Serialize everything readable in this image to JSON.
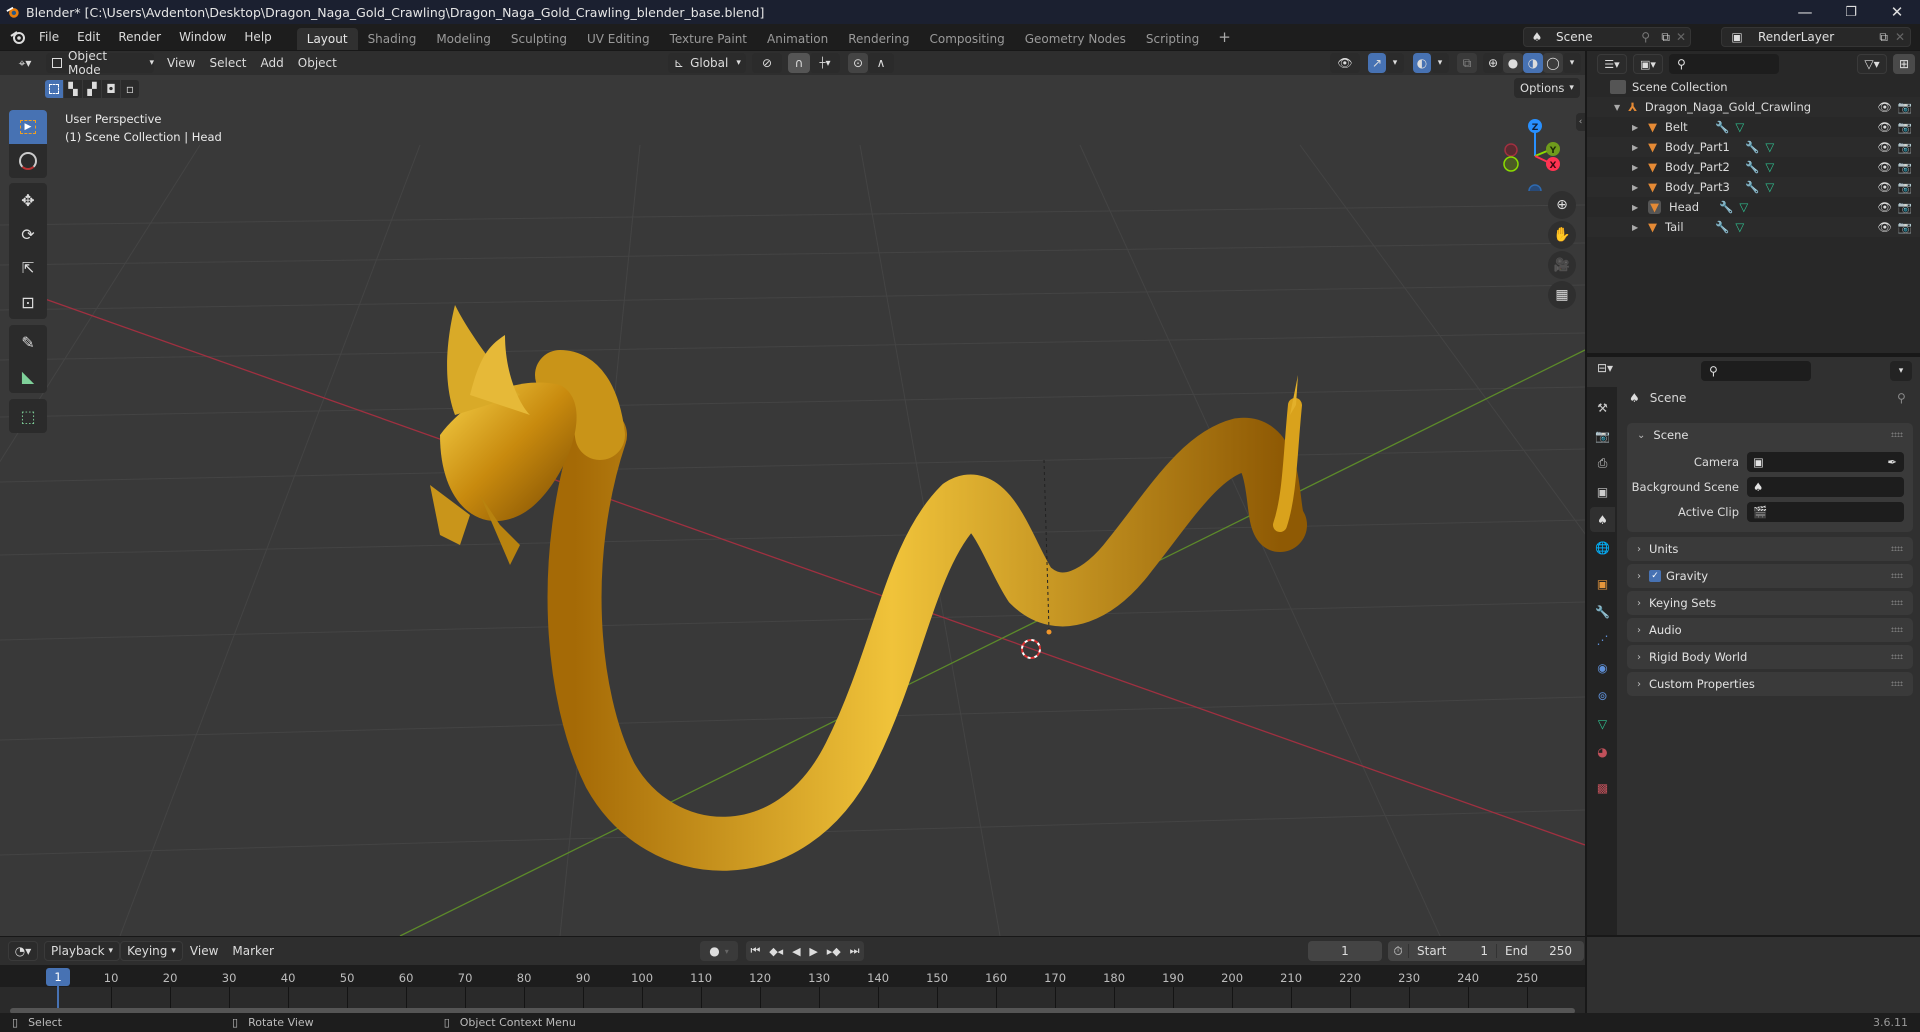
{
  "titlebar": {
    "title": "Blender* [C:\\Users\\Avdenton\\Desktop\\Dragon_Naga_Gold_Crawling\\Dragon_Naga_Gold_Crawling_blender_base.blend]",
    "minimize": "—",
    "maximize": "❐",
    "close": "✕"
  },
  "menubar": {
    "menus": [
      "File",
      "Edit",
      "Render",
      "Window",
      "Help"
    ],
    "workspaces": [
      "Layout",
      "Shading",
      "Modeling",
      "Sculpting",
      "UV Editing",
      "Texture Paint",
      "Animation",
      "Rendering",
      "Compositing",
      "Geometry Nodes",
      "Scripting"
    ],
    "active_workspace": "Layout",
    "add_workspace": "+",
    "scene_name": "Scene",
    "view_layer": "RenderLayer"
  },
  "viewport": {
    "mode": "Object Mode",
    "menus": [
      "View",
      "Select",
      "Add",
      "Object"
    ],
    "transform_orientation": "Global",
    "options_label": "Options",
    "overlay_text_1": "User Perspective",
    "overlay_text_2": "(1) Scene Collection | Head",
    "gizmo": {
      "z": "Z",
      "y": "Y",
      "x": "X"
    },
    "colors": {
      "x_axis": "#ff3352",
      "y_axis": "#8bdc00",
      "z_axis": "#2890ff",
      "gold": "#d4a017"
    }
  },
  "outliner": {
    "root": "Scene Collection",
    "collection": "Dragon_Naga_Gold_Crawling",
    "objects": [
      {
        "name": "Belt",
        "selected": false
      },
      {
        "name": "Body_Part1",
        "selected": false
      },
      {
        "name": "Body_Part2",
        "selected": false
      },
      {
        "name": "Body_Part3",
        "selected": false
      },
      {
        "name": "Head",
        "selected": true
      },
      {
        "name": "Tail",
        "selected": false
      }
    ]
  },
  "properties": {
    "context_title": "Scene",
    "scene_panel": {
      "title": "Scene",
      "rows": [
        {
          "label": "Camera",
          "value": ""
        },
        {
          "label": "Background Scene",
          "value": ""
        },
        {
          "label": "Active Clip",
          "value": ""
        }
      ]
    },
    "collapsed_panels": [
      {
        "title": "Units",
        "checkbox": false
      },
      {
        "title": "Gravity",
        "checkbox": true
      },
      {
        "title": "Keying Sets",
        "checkbox": false
      },
      {
        "title": "Audio",
        "checkbox": false
      },
      {
        "title": "Rigid Body World",
        "checkbox": false
      },
      {
        "title": "Custom Properties",
        "checkbox": false
      }
    ]
  },
  "timeline": {
    "menus": [
      "Playback",
      "Keying",
      "View",
      "Marker"
    ],
    "current_frame": "1",
    "start_label": "Start",
    "start": "1",
    "end_label": "End",
    "end": "250",
    "frame_ticks": [
      "10",
      "20",
      "30",
      "40",
      "50",
      "60",
      "70",
      "80",
      "90",
      "100",
      "110",
      "120",
      "130",
      "140",
      "150",
      "160",
      "170",
      "180",
      "190",
      "200",
      "210",
      "220",
      "230",
      "240",
      "250"
    ],
    "playhead": "1"
  },
  "statusbar": {
    "select": "Select",
    "rotate": "Rotate View",
    "context_menu": "Object Context Menu",
    "version": "3.6.11"
  }
}
